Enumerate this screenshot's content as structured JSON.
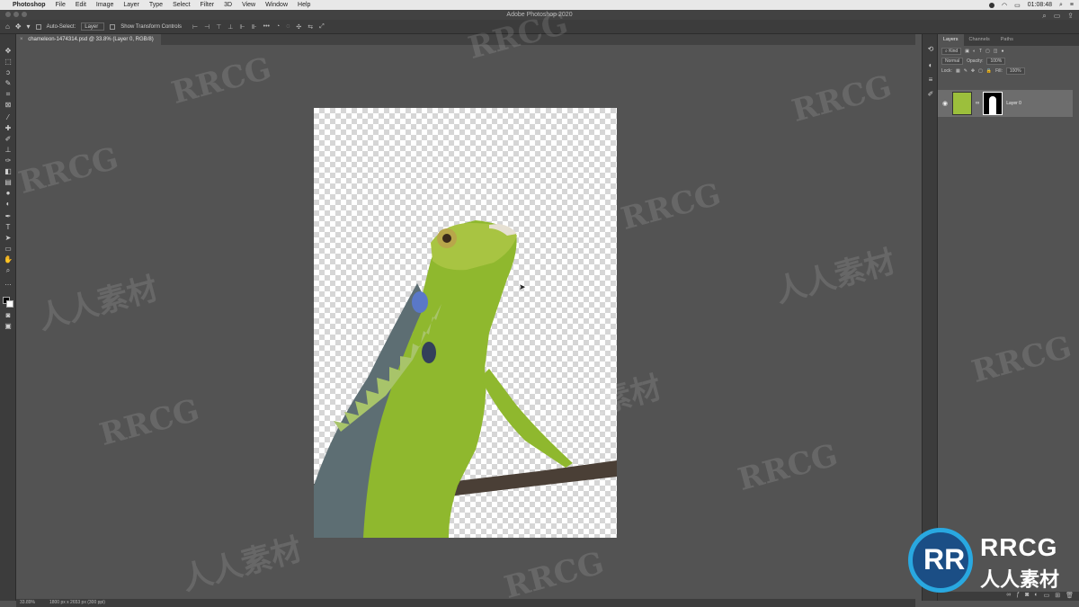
{
  "menubar": {
    "app": "Photoshop",
    "items": [
      "File",
      "Edit",
      "Image",
      "Layer",
      "Type",
      "Select",
      "Filter",
      "3D",
      "View",
      "Window",
      "Help"
    ],
    "clock": "01:08:48"
  },
  "window": {
    "title": "Adobe Photoshop 2020"
  },
  "options": {
    "auto_select_label": "Auto-Select:",
    "auto_select_value": "Layer",
    "transform_label": "Show Transform Controls",
    "more": "•••"
  },
  "document": {
    "tab_title": "chameleon-1474314.psd @ 33.8% (Layer 0, RGB/8)"
  },
  "status": {
    "zoom": "33.89%",
    "doc_info": "1800 px x 2653 px (300 ppi)"
  },
  "layers_panel": {
    "tabs": [
      "Layers",
      "Channels",
      "Paths"
    ],
    "kind_filter": "Kind",
    "blend_mode": "Normal",
    "opacity_label": "Opacity:",
    "opacity_value": "100%",
    "lock_label": "Lock:",
    "fill_label": "Fill:",
    "fill_value": "100%",
    "layer_name": "Layer 0"
  },
  "watermark": {
    "text_latin": "RRCG",
    "text_cn": "人人素材"
  },
  "logo": {
    "brand": "RRCG",
    "cn": "人人素材",
    "mark": "RR"
  },
  "colors": {
    "accent": "#29a8e0",
    "logo_dark": "#1b4e85",
    "chameleon_green": "#8fb82e"
  }
}
